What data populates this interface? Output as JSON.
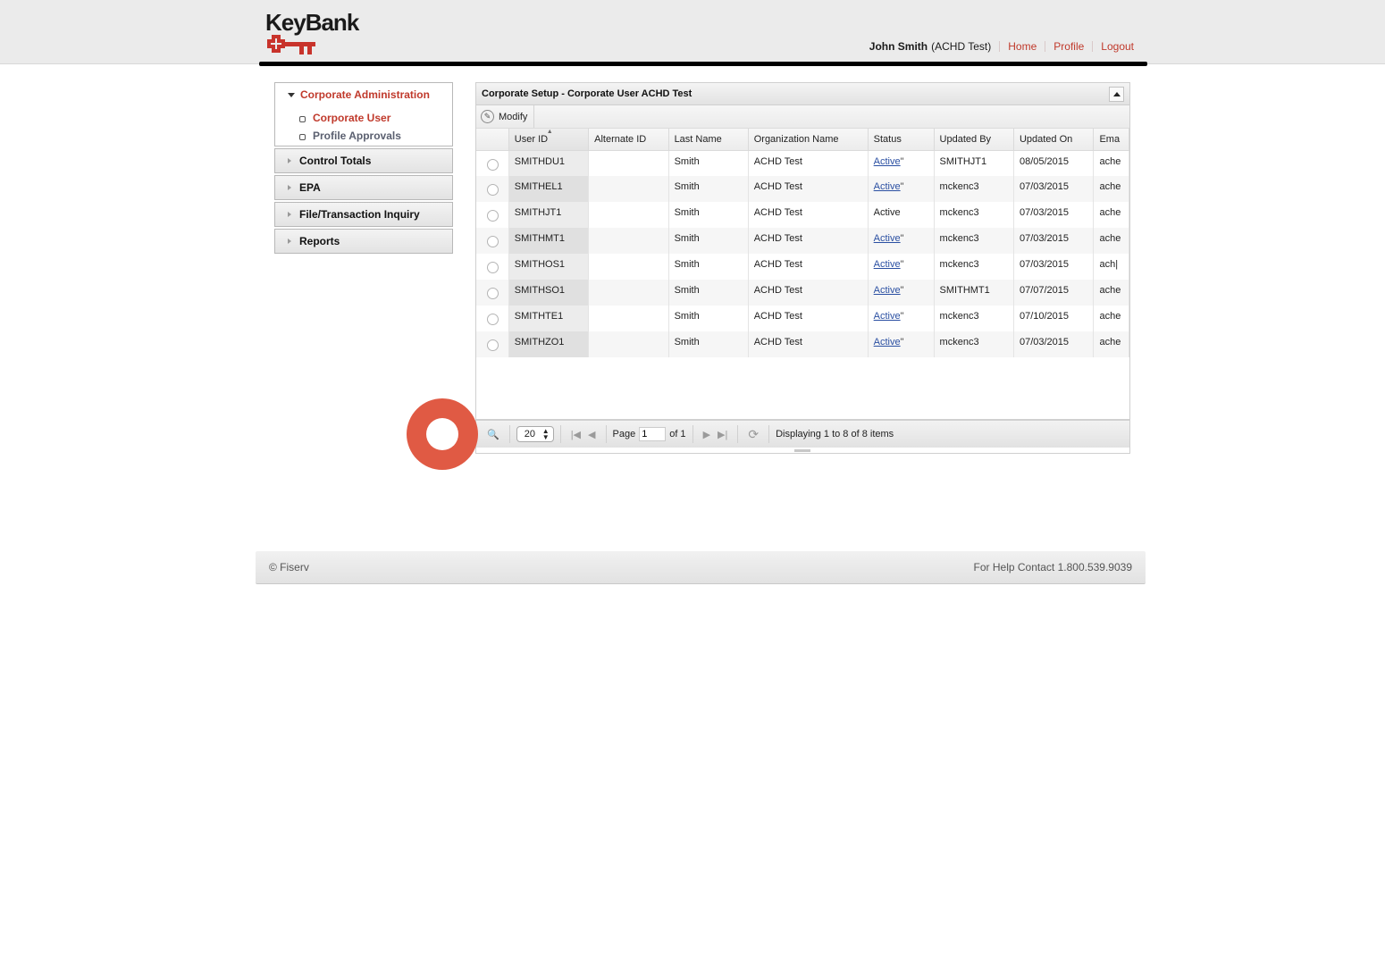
{
  "header": {
    "brand": "KeyBank",
    "user_name": "John Smith",
    "user_org": "(ACHD Test)",
    "links": [
      "Home",
      "Profile",
      "Logout"
    ],
    "accent_color": "#c0392b"
  },
  "sidebar": {
    "open_section": {
      "title": "Corporate Administration",
      "items": [
        {
          "label": "Corporate User",
          "active": true
        },
        {
          "label": "Profile Approvals",
          "active": false
        }
      ]
    },
    "sections": [
      "Control Totals",
      "EPA",
      "File/Transaction Inquiry",
      "Reports"
    ]
  },
  "panel": {
    "title": "Corporate Setup - Corporate User ACHD Test",
    "toolbar": {
      "modify_label": "Modify"
    },
    "columns": [
      "",
      "User ID",
      "Alternate ID",
      "Last Name",
      "Organization Name",
      "Status",
      "Updated By",
      "Updated On",
      "Ema"
    ],
    "sorted_column": "User ID",
    "rows": [
      {
        "user_id": "SMITHDU1",
        "alt_id": "",
        "last_name": "Smith",
        "org": "ACHD Test",
        "status": "Active",
        "status_link": true,
        "status_mark": "\"",
        "updated_by": "SMITHJT1",
        "updated_on": "08/05/2015",
        "email": "ache"
      },
      {
        "user_id": "SMITHEL1",
        "alt_id": "",
        "last_name": "Smith",
        "org": "ACHD Test",
        "status": "Active",
        "status_link": true,
        "status_mark": "\"",
        "updated_by": "mckenc3",
        "updated_on": "07/03/2015",
        "email": "ache"
      },
      {
        "user_id": "SMITHJT1",
        "alt_id": "",
        "last_name": "Smith",
        "org": "ACHD Test",
        "status": "Active",
        "status_link": false,
        "status_mark": "",
        "updated_by": "mckenc3",
        "updated_on": "07/03/2015",
        "email": "ache"
      },
      {
        "user_id": "SMITHMT1",
        "alt_id": "",
        "last_name": "Smith",
        "org": "ACHD Test",
        "status": "Active",
        "status_link": true,
        "status_mark": "\"",
        "updated_by": "mckenc3",
        "updated_on": "07/03/2015",
        "email": "ache"
      },
      {
        "user_id": "SMITHOS1",
        "alt_id": "",
        "last_name": "Smith",
        "org": "ACHD Test",
        "status": "Active",
        "status_link": true,
        "status_mark": "\"",
        "updated_by": "mckenc3",
        "updated_on": "07/03/2015",
        "email": "ach|"
      },
      {
        "user_id": "SMITHSO1",
        "alt_id": "",
        "last_name": "Smith",
        "org": "ACHD Test",
        "status": "Active",
        "status_link": true,
        "status_mark": "\"",
        "updated_by": "SMITHMT1",
        "updated_on": "07/07/2015",
        "email": "ache"
      },
      {
        "user_id": "SMITHTE1",
        "alt_id": "",
        "last_name": "Smith",
        "org": "ACHD Test",
        "status": "Active",
        "status_link": true,
        "status_mark": "\"",
        "updated_by": "mckenc3",
        "updated_on": "07/10/2015",
        "email": "ache"
      },
      {
        "user_id": "SMITHZO1",
        "alt_id": "",
        "last_name": "Smith",
        "org": "ACHD Test",
        "status": "Active",
        "status_link": true,
        "status_mark": "\"",
        "updated_by": "mckenc3",
        "updated_on": "07/03/2015",
        "email": "ache"
      }
    ],
    "pager": {
      "page_size": "20",
      "page_label": "Page",
      "page_value": "1",
      "of_label": "of 1",
      "display_text": "Displaying 1 to 8 of 8 items"
    }
  },
  "footer": {
    "copyright": "© Fiserv",
    "help": "For Help Contact 1.800.539.9039"
  }
}
